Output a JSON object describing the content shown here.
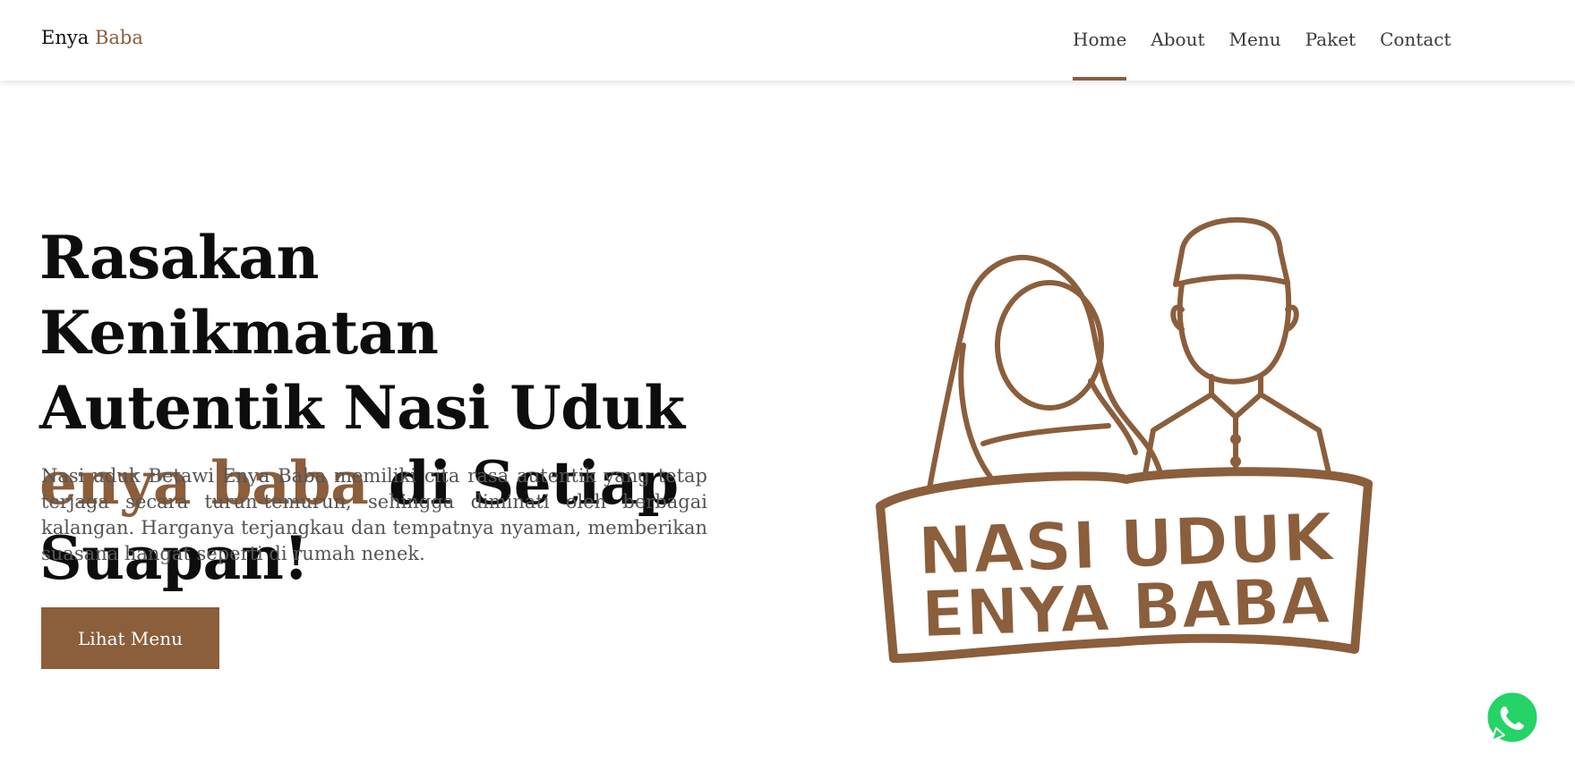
{
  "brand": {
    "first": "Enya",
    "second": "Baba"
  },
  "nav": {
    "items": [
      {
        "label": "Home",
        "active": true
      },
      {
        "label": "About",
        "active": false
      },
      {
        "label": "Menu",
        "active": false
      },
      {
        "label": "Paket",
        "active": false
      },
      {
        "label": "Contact",
        "active": false
      }
    ]
  },
  "hero": {
    "title_part1": "Rasakan Kenikmatan Autentik Nasi Uduk ",
    "title_accent": "enya baba",
    "title_part2": " di Setiap Suapan!",
    "description": "Nasi uduk Betawi Enya Baba memiliki cita rasa autentik yang tetap terjaga secara turun-temurun, sehingga diminati oleh berbagai kalangan. Harganya terjangkau dan tempatnya nyaman, memberikan suasana hangat seperti di rumah nenek.",
    "cta_label": "Lihat Menu"
  },
  "logo": {
    "line1": "NASI UDUK",
    "line2": "ENYA BABA"
  },
  "colors": {
    "accent": "#8b5e3c",
    "whatsapp": "#25d366"
  },
  "icons": {
    "whatsapp": "whatsapp-icon"
  }
}
